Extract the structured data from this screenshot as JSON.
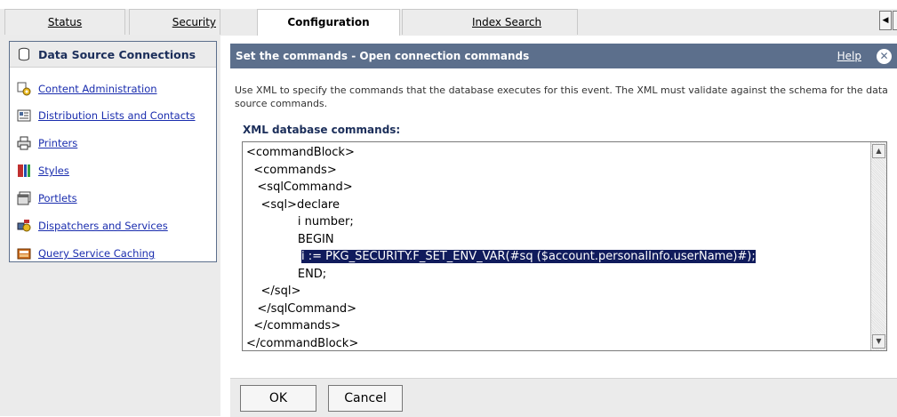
{
  "tabs": {
    "status": "Status",
    "security": "Security",
    "configuration": "Configuration",
    "index_search": "Index Search"
  },
  "sidebar": {
    "items": [
      {
        "label": "Data Source Connections",
        "icon": "database-icon",
        "active": true
      },
      {
        "label": "Content Administration",
        "icon": "content-admin-icon"
      },
      {
        "label": "Distribution Lists and Contacts",
        "icon": "contacts-icon"
      },
      {
        "label": "Printers",
        "icon": "printer-icon"
      },
      {
        "label": "Styles",
        "icon": "styles-icon"
      },
      {
        "label": "Portlets",
        "icon": "portlets-icon"
      },
      {
        "label": "Dispatchers and Services",
        "icon": "dispatchers-icon"
      },
      {
        "label": "Query Service Caching",
        "icon": "query-cache-icon"
      }
    ]
  },
  "panel": {
    "title": "Set the commands - Open connection commands",
    "help": "Help",
    "description": "Use XML to specify the commands that the database executes for this event. The XML must validate against the schema for the data source commands.",
    "xml_label": "XML database commands:",
    "xml_lines": [
      "<commandBlock>",
      "  <commands>",
      "   <sqlCommand>",
      "    <sql>declare",
      "              i number;",
      "              BEGIN",
      "               i := PKG_SECURITY.F_SET_ENV_VAR(#sq ($account.personalInfo.userName)#);",
      "              END;",
      "    </sql>",
      "   </sqlCommand>",
      "  </commands>",
      "</commandBlock>"
    ],
    "selected_line_index": 6
  },
  "buttons": {
    "ok": "OK",
    "cancel": "Cancel"
  },
  "colors": {
    "header_bg": "#5c6f8c",
    "selection_bg": "#101b5c",
    "link": "#1a2dae"
  }
}
